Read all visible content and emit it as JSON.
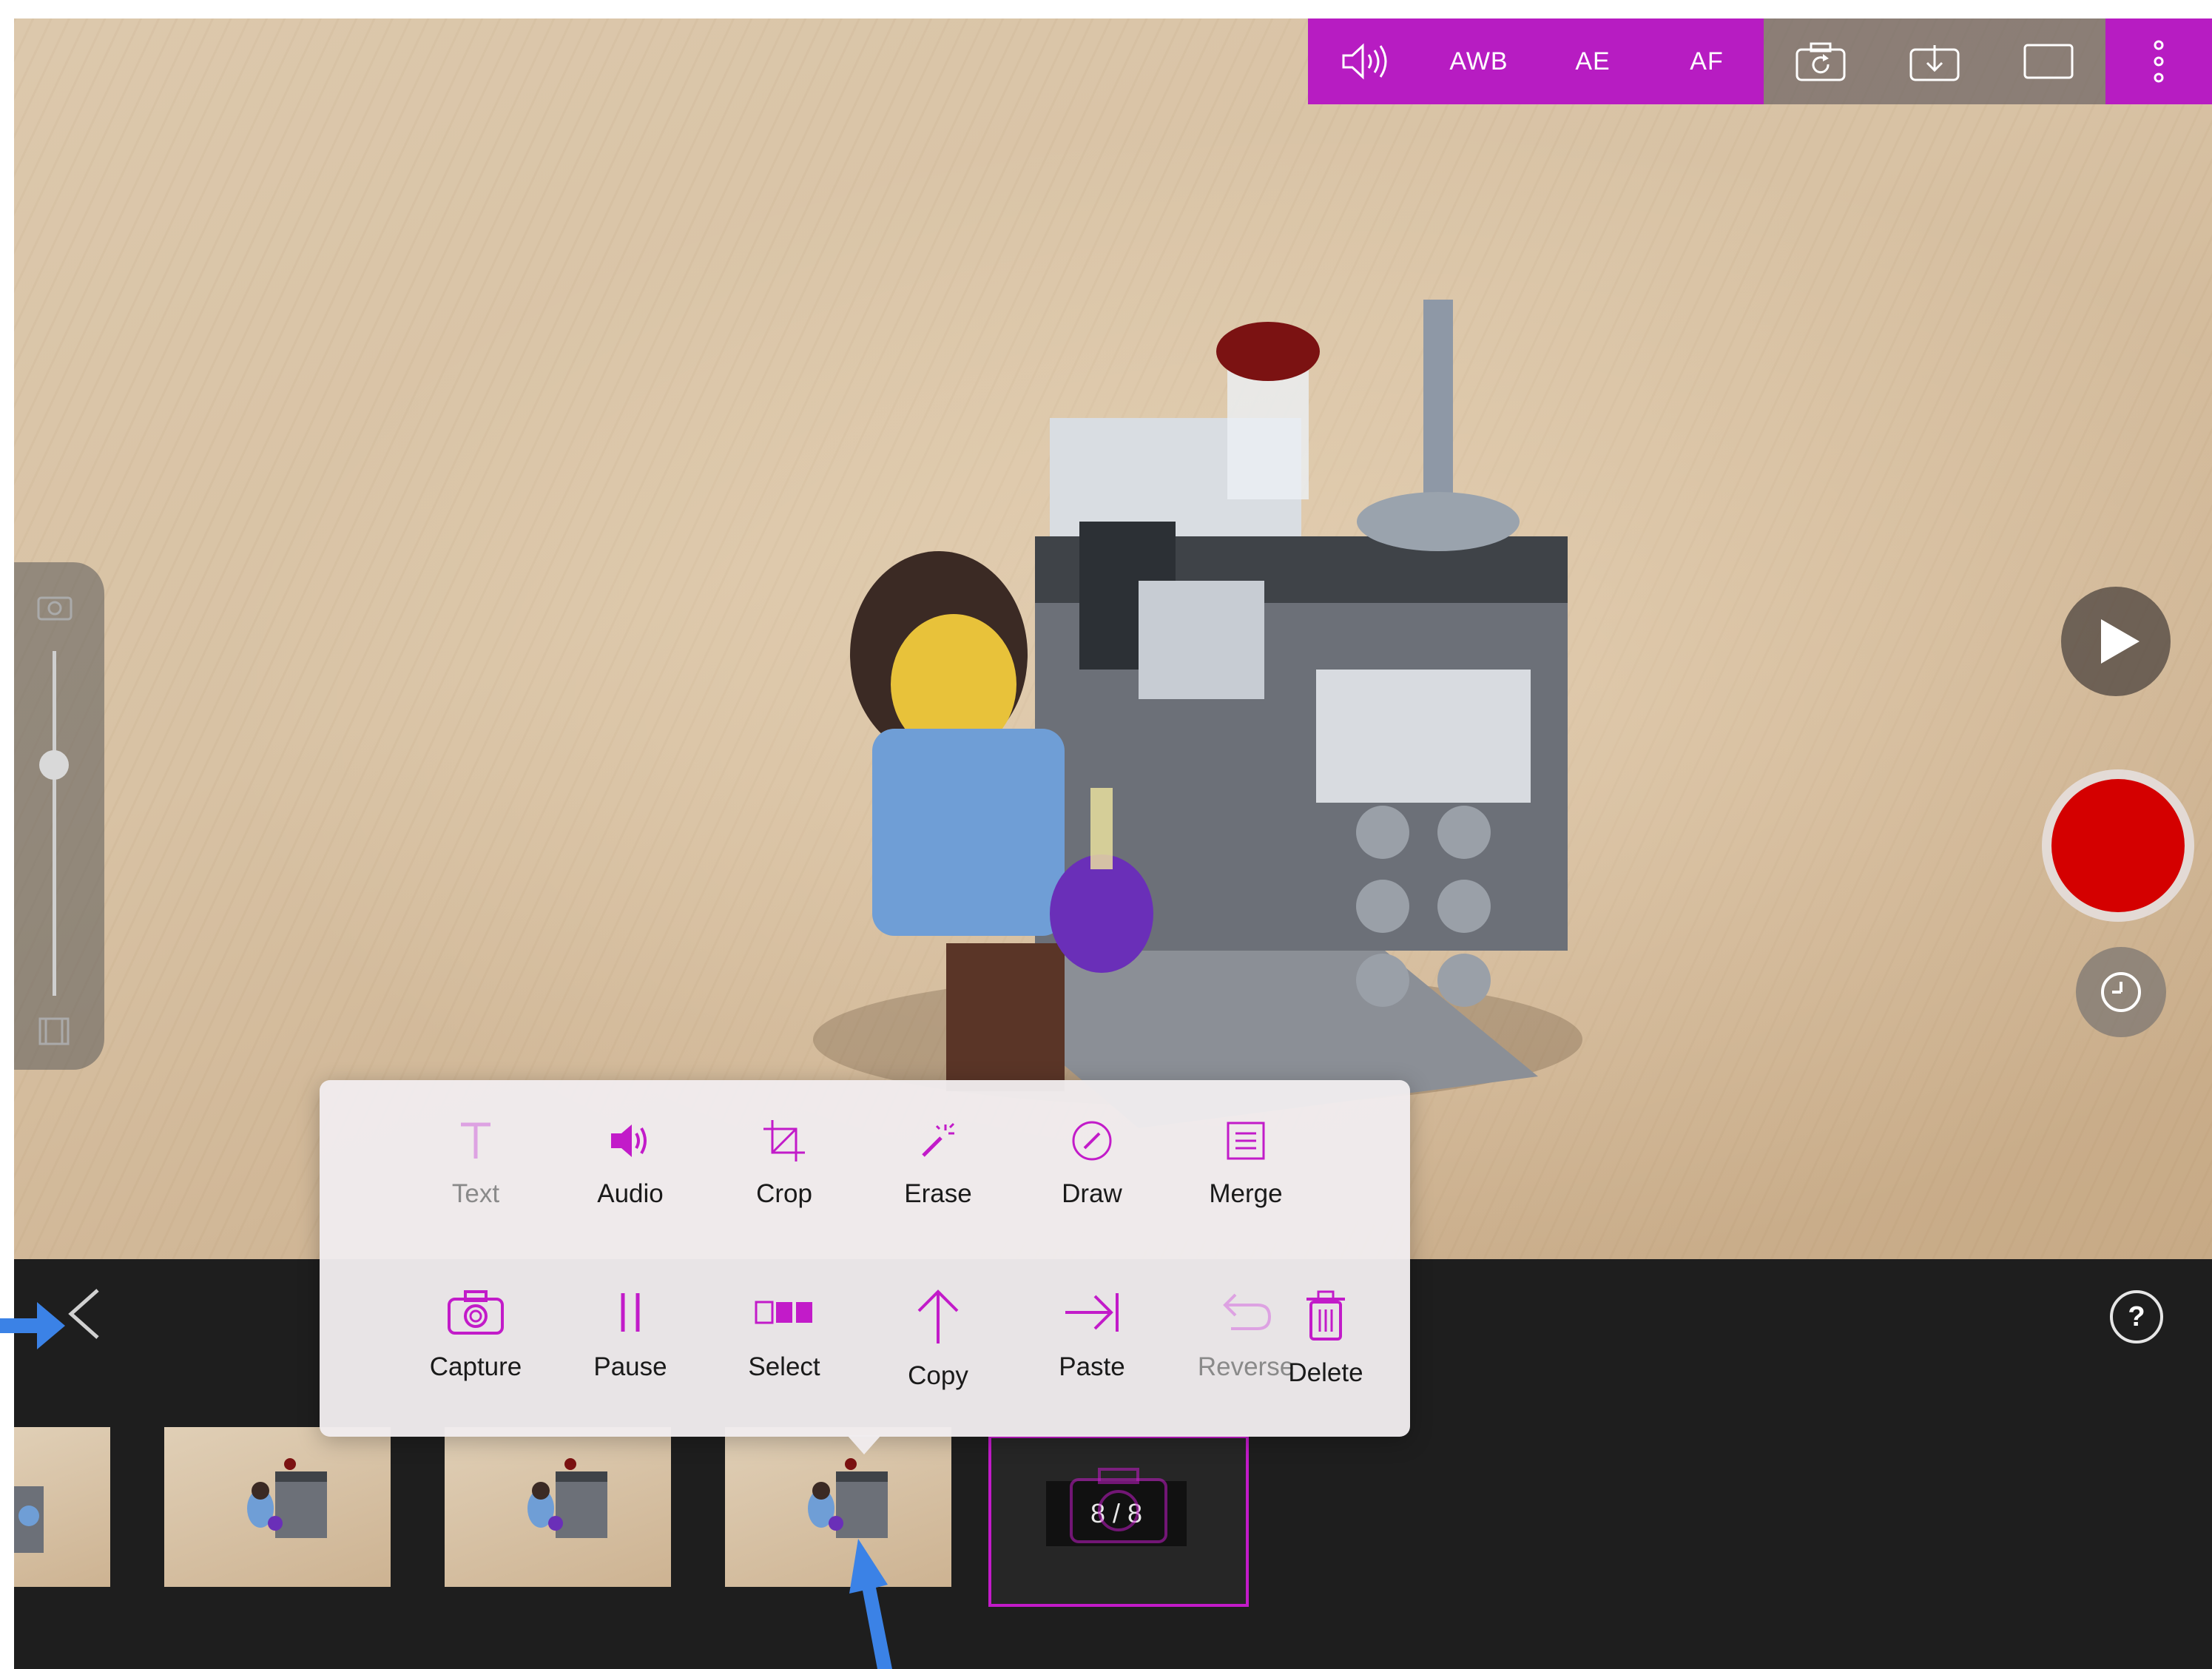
{
  "toolbar": {
    "items": [
      {
        "icon": "volume-icon"
      },
      {
        "label": "AWB"
      },
      {
        "label": "AE"
      },
      {
        "label": "AF"
      },
      {
        "icon": "camera-flip-icon"
      },
      {
        "icon": "import-icon"
      },
      {
        "icon": "aspect-ratio-icon"
      },
      {
        "icon": "more-vertical-icon"
      }
    ],
    "purple_color": "#b71cc2"
  },
  "zoom_slider": {
    "value": 0.33
  },
  "edit_menu": {
    "accent_color": "#c21bc9",
    "row1": [
      {
        "label": "Text",
        "icon": "text-icon",
        "disabled": true
      },
      {
        "label": "Audio",
        "icon": "speaker-icon",
        "disabled": false
      },
      {
        "label": "Crop",
        "icon": "crop-icon",
        "disabled": false
      },
      {
        "label": "Erase",
        "icon": "magic-wand-icon",
        "disabled": false
      },
      {
        "label": "Draw",
        "icon": "pencil-circle-icon",
        "disabled": false
      },
      {
        "label": "Merge",
        "icon": "merge-icon",
        "disabled": false
      }
    ],
    "row2": [
      {
        "label": "Capture",
        "icon": "camera-icon",
        "disabled": false
      },
      {
        "label": "Pause",
        "icon": "pause-icon",
        "disabled": false
      },
      {
        "label": "Select",
        "icon": "select-icon",
        "disabled": false
      },
      {
        "label": "Copy",
        "icon": "arrow-up-icon",
        "disabled": false
      },
      {
        "label": "Paste",
        "icon": "arrow-right-bar-icon",
        "disabled": false
      },
      {
        "label": "Reverse",
        "icon": "undo-icon",
        "disabled": true
      },
      {
        "label": "Delete",
        "icon": "trash-icon",
        "disabled": false
      }
    ]
  },
  "frame_counter": "8 / 8",
  "record_color": "#d40000"
}
